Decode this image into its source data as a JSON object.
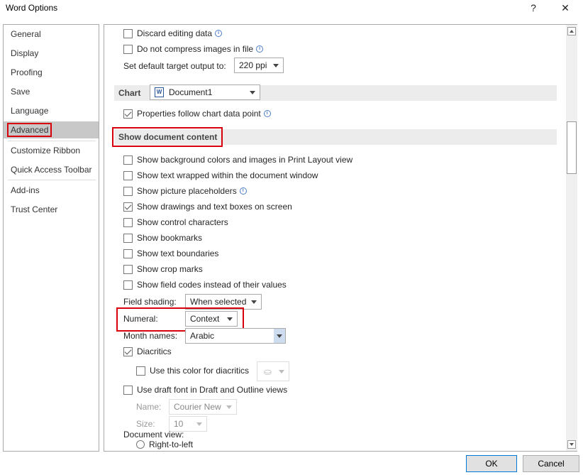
{
  "window": {
    "title": "Word Options",
    "help_label": "?",
    "close_label": "✕"
  },
  "sidebar": {
    "items": [
      {
        "label": "General"
      },
      {
        "label": "Display"
      },
      {
        "label": "Proofing"
      },
      {
        "label": "Save"
      },
      {
        "label": "Language"
      },
      {
        "label": "Advanced",
        "selected": true
      },
      {
        "label": "Customize Ribbon"
      },
      {
        "label": "Quick Access Toolbar"
      },
      {
        "label": "Add-ins"
      },
      {
        "label": "Trust Center"
      }
    ]
  },
  "image_options": {
    "discard_editing": {
      "label": "Discard editing data",
      "checked": false
    },
    "no_compress": {
      "label": "Do not compress images in file",
      "checked": false
    },
    "target_output_label": "Set default target output to:",
    "target_output_value": "220 ppi"
  },
  "chart": {
    "header": "Chart",
    "document": "Document1",
    "properties_follow": {
      "label": "Properties follow chart data point",
      "checked": true
    }
  },
  "show_document_content": {
    "header": "Show document content",
    "options": [
      {
        "label": "Show background colors and images in Print Layout view",
        "checked": false
      },
      {
        "label": "Show text wrapped within the document window",
        "checked": false
      },
      {
        "label": "Show picture placeholders",
        "checked": false,
        "info": true
      },
      {
        "label": "Show drawings and text boxes on screen",
        "checked": true
      },
      {
        "label": "Show control characters",
        "checked": false
      },
      {
        "label": "Show bookmarks",
        "checked": false
      },
      {
        "label": "Show text boundaries",
        "checked": false
      },
      {
        "label": "Show crop marks",
        "checked": false
      },
      {
        "label": "Show field codes instead of their values",
        "checked": false
      }
    ],
    "field_shading_label": "Field shading:",
    "field_shading_value": "When selected",
    "numeral_label": "Numeral:",
    "numeral_value": "Context",
    "month_names_label": "Month names:",
    "month_names_value": "Arabic",
    "diacritics": {
      "label": "Diacritics",
      "checked": true
    },
    "diacritics_color": {
      "label": "Use this color for diacritics",
      "checked": false
    },
    "draft_font": {
      "label": "Use draft font in Draft and Outline views",
      "checked": false
    },
    "name_label": "Name:",
    "name_value": "Courier New",
    "size_label": "Size:",
    "size_value": "10",
    "document_view_label": "Document view:",
    "right_to_left_label": "Right-to-left"
  },
  "footer": {
    "ok_label": "OK",
    "cancel_label": "Cancel"
  },
  "colors": {
    "highlight": "#d9000d",
    "selected_bg": "#c8c8c8"
  }
}
